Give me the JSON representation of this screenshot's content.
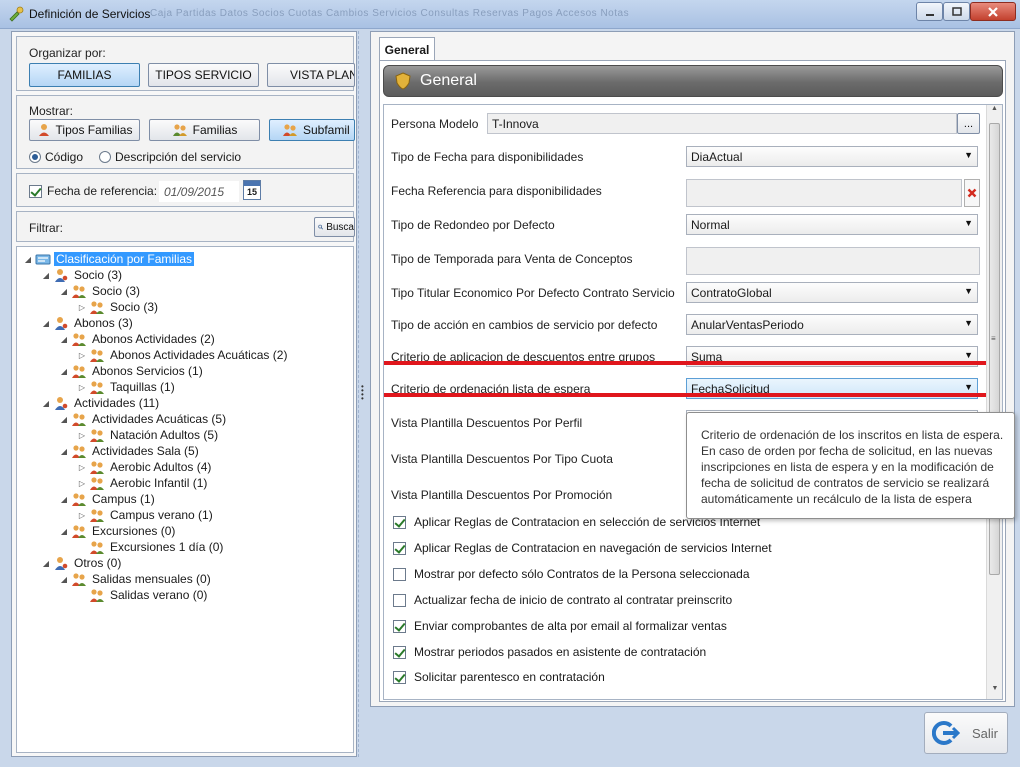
{
  "window": {
    "title": "Definición de Servicios",
    "ghost_text": "Caja   Partidas   Datos   Socios   Cuotas   Cambios   Servicios   Consultas   Reservas   Pagos   Accesos   Notas"
  },
  "left": {
    "organize_label": "Organizar por:",
    "organize_buttons": [
      "FAMILIAS",
      "TIPOS SERVICIO",
      "VISTA PLAN"
    ],
    "show_label": "Mostrar:",
    "show_buttons": [
      "Tipos Familias",
      "Familias",
      "Subfamil"
    ],
    "radio_codigo": "Código",
    "radio_descripcion": "Descripción del servicio",
    "fecha_label": "Fecha de referencia:",
    "fecha_value": "01/09/2015",
    "calendar_day": "15",
    "filter_label": "Filtrar:",
    "search_button": "Busca",
    "tree": [
      "Clasificación por Familias",
      "Socio (3)",
      "Socio (3)",
      "Socio (3)",
      "Abonos (3)",
      "Abonos Actividades (2)",
      "Abonos Actividades Acuáticas (2)",
      "Abonos Servicios (1)",
      "Taquillas (1)",
      "Actividades (11)",
      "Actividades Acuáticas (5)",
      "Natación Adultos (5)",
      "Actividades Sala (5)",
      "Aerobic Adultos (4)",
      "Aerobic Infantil (1)",
      "Campus (1)",
      "Campus verano (1)",
      "Excursiones (0)",
      "Excursiones 1 día (0)",
      "Otros (0)",
      "Salidas mensuales (0)",
      "Salidas verano (0)"
    ]
  },
  "right": {
    "tab": "General",
    "header": "General",
    "props": [
      {
        "label": "Persona Modelo",
        "value": "T-Innova"
      },
      {
        "label": "Tipo de Fecha para disponibilidades",
        "value": "DiaActual"
      },
      {
        "label": "Fecha Referencia para disponibilidades",
        "value": ""
      },
      {
        "label": "Tipo de Redondeo por Defecto",
        "value": "Normal"
      },
      {
        "label": "Tipo de Temporada para Venta de Conceptos",
        "value": ""
      },
      {
        "label": "Tipo Titular Economico Por Defecto Contrato Servicio",
        "value": "ContratoGlobal"
      },
      {
        "label": "Tipo de acción en cambios de servicio por defecto",
        "value": "AnularVentasPeriodo"
      },
      {
        "label": "Criterio de aplicacion de descuentos entre grupos",
        "value": "Suma"
      },
      {
        "label": "Criterio de ordenación lista de espera",
        "value": "FechaSolicitud"
      },
      {
        "label": "Vista Plantilla Descuentos Por Perfil",
        "value": ""
      },
      {
        "label": "Vista Plantilla Descuentos Por Tipo Cuota",
        "value": ""
      },
      {
        "label": "Vista Plantilla Descuentos Por Promoción",
        "value": ""
      }
    ],
    "ellipsis": "...",
    "checks": [
      "Aplicar Reglas de Contratacion en selección de servicios Internet",
      "Aplicar Reglas de Contratacion en navegación de servicios Internet",
      "Mostrar por defecto sólo Contratos de la Persona seleccionada",
      "Actualizar fecha de inicio de contrato al contratar preinscrito",
      "Enviar comprobantes de alta por email al formalizar ventas",
      "Mostrar periodos pasados en asistente de contratación",
      "Solicitar parentesco en contratación"
    ],
    "check_states": [
      true,
      true,
      false,
      false,
      true,
      true,
      true
    ],
    "tooltip": "Criterio de ordenación de los inscritos en lista de espera. En caso de orden por fecha de solicitud, en las nuevas inscripciones en lista de espera y en la modificación de fecha de solicitud de contratos de servicio se realizará automáticamente un recálculo de la lista de espera"
  },
  "footer": {
    "exit_button": "Salir"
  },
  "colors": {
    "accent": "#3399ff",
    "highlight": "#e0161c",
    "header": "#6b6b6b"
  }
}
